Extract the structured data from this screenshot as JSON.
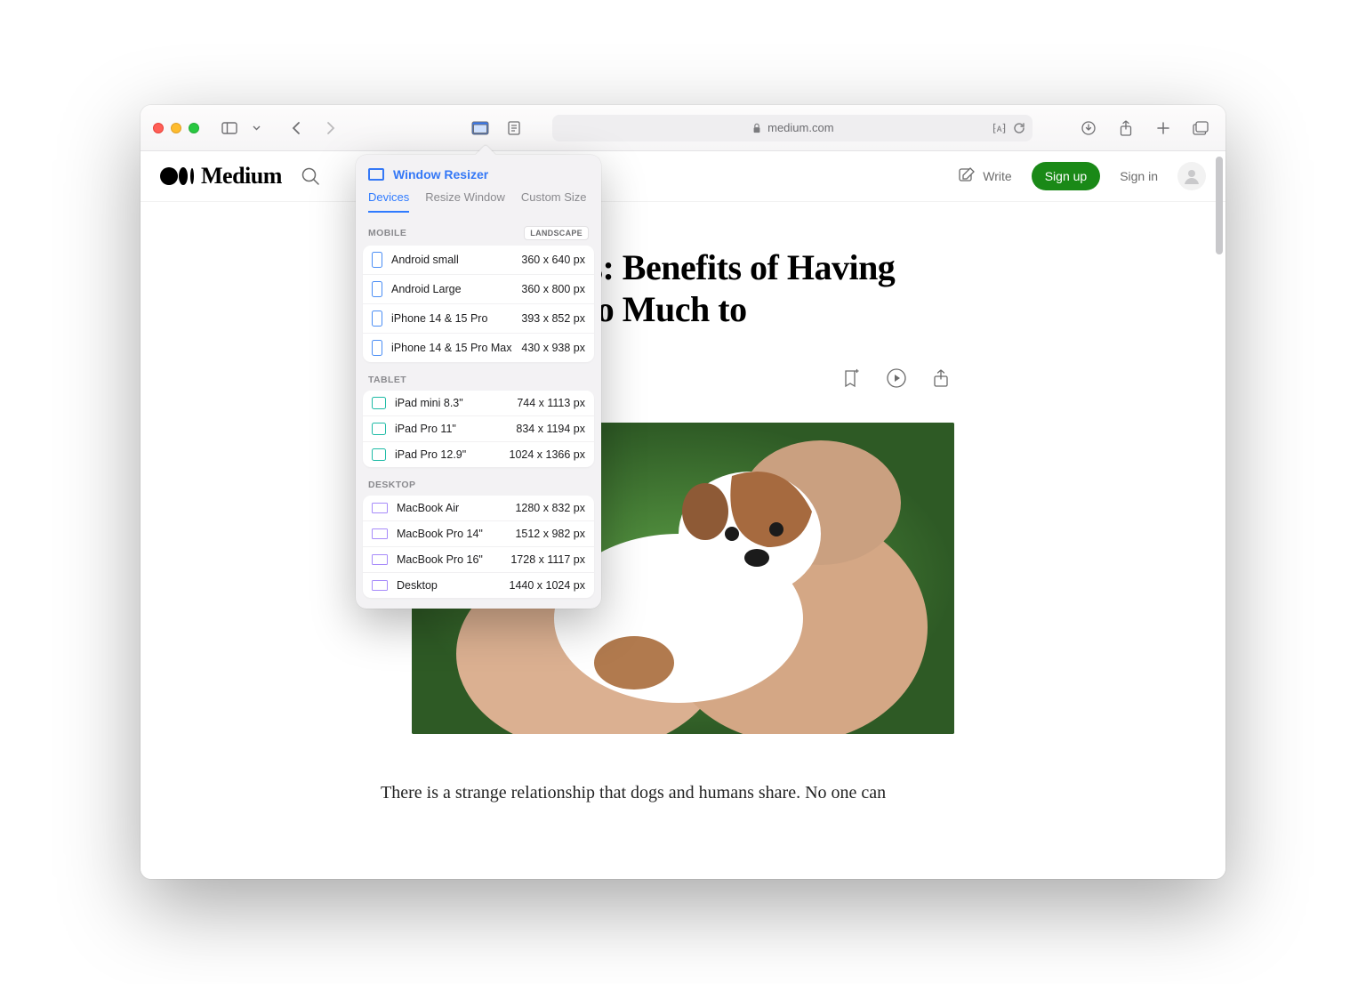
{
  "browser": {
    "url_host": "medium.com"
  },
  "popover": {
    "title": "Window Resizer",
    "tabs": {
      "devices": "Devices",
      "resize": "Resize Window",
      "custom": "Custom Size"
    },
    "orientation_badge": "LANDSCAPE",
    "sections": {
      "mobile": {
        "label": "MOBILE",
        "items": [
          {
            "name": "Android small",
            "dim": "360 x 640 px"
          },
          {
            "name": "Android Large",
            "dim": "360 x 800 px"
          },
          {
            "name": "iPhone 14 & 15 Pro",
            "dim": "393 x 852 px"
          },
          {
            "name": "iPhone 14 & 15 Pro Max",
            "dim": "430 x 938 px"
          }
        ]
      },
      "tablet": {
        "label": "TABLET",
        "items": [
          {
            "name": "iPad mini 8.3\"",
            "dim": "744 x 1113 px"
          },
          {
            "name": "iPad Pro 11\"",
            "dim": "834 x 1194 px"
          },
          {
            "name": "iPad Pro 12.9\"",
            "dim": "1024 x 1366 px"
          }
        ]
      },
      "desktop": {
        "label": "DESKTOP",
        "items": [
          {
            "name": "MacBook Air",
            "dim": "1280 x 832 px"
          },
          {
            "name": "MacBook Pro 14\"",
            "dim": "1512 x 982 px"
          },
          {
            "name": "MacBook Pro 16\"",
            "dim": "1728 x 1117 px"
          },
          {
            "name": "Desktop",
            "dim": "1440 x 1024 px"
          }
        ]
      }
    }
  },
  "medium": {
    "brand": "Medium",
    "write": "Write",
    "signup": "Sign up",
    "signin": "Sign in"
  },
  "article": {
    "title_visible": "ecies: Benefits of Having\ny They Mean so Much to",
    "body_first_line": "There is a strange relationship that dogs and humans share. No one can"
  }
}
